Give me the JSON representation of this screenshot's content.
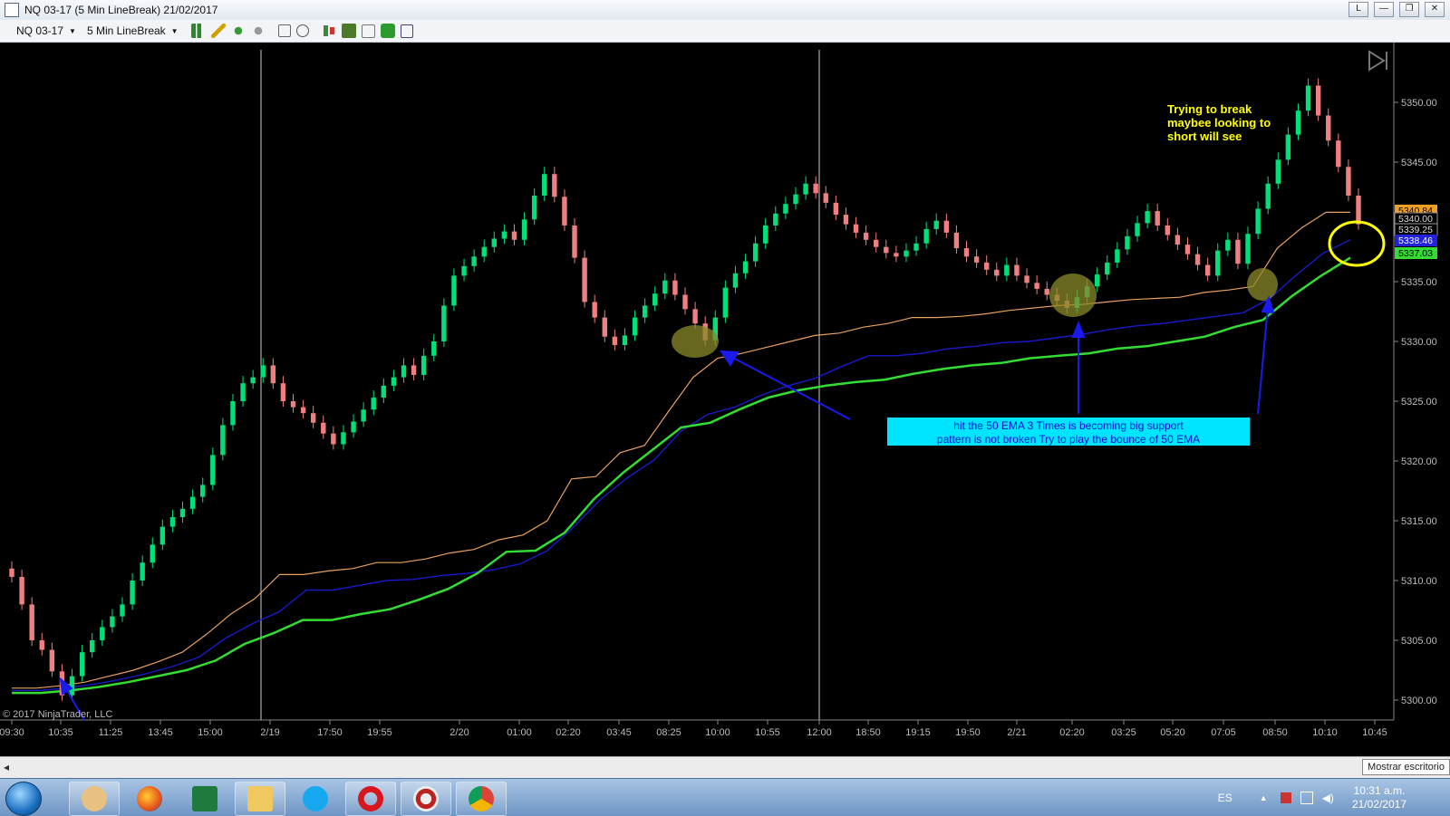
{
  "window": {
    "title": "NQ 03-17 (5 Min LineBreak)  21/02/2017",
    "btn_l": "L",
    "btn_min": "—",
    "btn_max": "❐",
    "btn_close": "✕"
  },
  "toolbar": {
    "instrument": "NQ 03-17",
    "period": "5 Min LineBreak"
  },
  "colors": {
    "up": "#00e07a",
    "down": "#f08080",
    "ema_orange": "#e8a060",
    "ema_blue": "#1a1acc",
    "ema_green": "#33dd33",
    "note_bg": "#00e5ff",
    "note_text": "#1010d0",
    "annotation_yellow": "#ffff00"
  },
  "chart_data": {
    "type": "line",
    "title": "",
    "y_range": [
      5297.5,
      5353.0
    ],
    "y_ticks": [
      "5350.00",
      "5345.00",
      "5340.00",
      "5335.00",
      "5330.00",
      "5325.00",
      "5320.00",
      "5315.00",
      "5310.00",
      "5305.00",
      "5300.00"
    ],
    "x_ticks": [
      "09:30",
      "10:35",
      "11:25",
      "13:45",
      "15:00",
      "2/19",
      "17:50",
      "19:55",
      "2/20",
      "01:00",
      "02:20",
      "03:45",
      "08:25",
      "10:00",
      "10:55",
      "12:00",
      "18:50",
      "19:15",
      "19:50",
      "2/21",
      "02:20",
      "03:25",
      "05:20",
      "07:05",
      "08:50",
      "10:10",
      "10:45"
    ],
    "price_labels": [
      {
        "text": "5340.84",
        "color": "orange",
        "value": 5340.84
      },
      {
        "text": "5340.00",
        "color": "white",
        "value": 5340.0
      },
      {
        "text": "5339.25",
        "color": "white",
        "value": 5339.25
      },
      {
        "text": "5338.46",
        "color": "blue",
        "value": 5338.46
      },
      {
        "text": "5337.03",
        "color": "green",
        "value": 5337.03
      }
    ],
    "bars_close": [
      5310.3,
      5308.0,
      5305.0,
      5304.2,
      5302.4,
      5300.4,
      5302.0,
      5304.0,
      5305.0,
      5306.1,
      5307.0,
      5308.0,
      5310.0,
      5311.5,
      5313.0,
      5314.5,
      5315.3,
      5316.0,
      5317.0,
      5318.0,
      5320.5,
      5323.0,
      5325.0,
      5326.5,
      5327.0,
      5328.0,
      5326.5,
      5325.0,
      5324.5,
      5324.0,
      5323.2,
      5322.3,
      5321.4,
      5322.4,
      5323.3,
      5324.3,
      5325.3,
      5326.3,
      5327.0,
      5328.0,
      5327.2,
      5328.8,
      5330.0,
      5333.0,
      5335.5,
      5336.3,
      5337.1,
      5337.9,
      5338.6,
      5339.2,
      5338.5,
      5340.2,
      5342.2,
      5344.0,
      5342.1,
      5339.7,
      5337.0,
      5333.3,
      5332.0,
      5330.4,
      5329.7,
      5330.5,
      5332.0,
      5333.0,
      5334.0,
      5335.1,
      5333.9,
      5332.7,
      5331.5,
      5330.1,
      5332.0,
      5334.5,
      5335.7,
      5336.7,
      5338.2,
      5339.7,
      5340.7,
      5341.5,
      5342.3,
      5343.2,
      5342.4,
      5341.6,
      5340.6,
      5339.8,
      5339.1,
      5338.5,
      5337.9,
      5337.4,
      5337.1,
      5337.6,
      5338.2,
      5339.4,
      5340.1,
      5339.1,
      5337.8,
      5337.1,
      5336.6,
      5336.0,
      5335.5,
      5336.4,
      5335.5,
      5334.9,
      5334.4,
      5333.9,
      5333.4,
      5332.8,
      5333.7,
      5334.6,
      5335.6,
      5336.6,
      5337.7,
      5338.8,
      5339.9,
      5340.9,
      5339.7,
      5338.9,
      5338.1,
      5337.3,
      5336.4,
      5335.5,
      5337.6,
      5338.5,
      5336.5,
      5339.0,
      5341.1,
      5343.2,
      5345.2,
      5347.3,
      5349.3,
      5351.4,
      5348.9,
      5346.8,
      5344.6,
      5342.2,
      5339.8
    ],
    "ema_orange": [
      5301.0,
      5301.0,
      5301.2,
      5301.5,
      5302.0,
      5302.5,
      5303.2,
      5304.0,
      5305.5,
      5307.2,
      5308.5,
      5310.5,
      5310.5,
      5310.8,
      5311.0,
      5311.5,
      5311.5,
      5311.8,
      5312.3,
      5312.6,
      5313.4,
      5313.8,
      5315.0,
      5318.5,
      5318.7,
      5320.7,
      5321.3,
      5324.2,
      5327.0,
      5328.6,
      5329.0,
      5329.5,
      5330.0,
      5330.5,
      5330.7,
      5331.2,
      5331.5,
      5332.0,
      5332.0,
      5332.1,
      5332.3,
      5332.6,
      5332.8,
      5333.0,
      5333.1,
      5333.3,
      5333.5,
      5333.6,
      5333.7,
      5334.1,
      5334.3,
      5334.6,
      5337.8,
      5339.5,
      5340.8,
      5340.8
    ],
    "ema_blue": [
      5300.8,
      5300.8,
      5301.0,
      5301.3,
      5301.7,
      5302.2,
      5302.8,
      5303.6,
      5305.2,
      5306.4,
      5307.4,
      5309.2,
      5309.2,
      5309.6,
      5310.0,
      5310.1,
      5310.4,
      5310.6,
      5310.9,
      5311.4,
      5312.5,
      5314.5,
      5316.8,
      5318.6,
      5320.1,
      5322.5,
      5323.9,
      5324.5,
      5325.5,
      5326.3,
      5326.9,
      5327.9,
      5328.8,
      5328.8,
      5329.0,
      5329.4,
      5329.6,
      5329.9,
      5330.0,
      5330.3,
      5330.6,
      5331.0,
      5331.3,
      5331.5,
      5331.8,
      5332.1,
      5332.4,
      5333.6,
      5335.6,
      5337.4,
      5338.5
    ],
    "ema_green": [
      5300.6,
      5300.6,
      5300.8,
      5301.1,
      5301.5,
      5302.0,
      5302.5,
      5303.3,
      5304.7,
      5305.6,
      5306.7,
      5306.7,
      5307.2,
      5307.6,
      5308.4,
      5309.3,
      5310.6,
      5312.4,
      5312.5,
      5314.0,
      5316.8,
      5319.0,
      5320.9,
      5322.8,
      5323.2,
      5324.3,
      5325.3,
      5325.9,
      5326.3,
      5326.6,
      5326.8,
      5327.3,
      5327.7,
      5328.0,
      5328.2,
      5328.6,
      5328.8,
      5329.0,
      5329.4,
      5329.6,
      5330.0,
      5330.4,
      5331.2,
      5331.8,
      5333.8,
      5335.5,
      5337.0
    ]
  },
  "annotations": {
    "top_note": [
      "Trying to break",
      "maybee looking to",
      "short will see"
    ],
    "box_note": [
      "hit the 50 EMA 3 Times is becoming big support",
      "pattern is not broken Try to play the bounce of 50 EMA"
    ],
    "copyright": "© 2017 NinjaTrader, LLC"
  },
  "status": {
    "tooltip": "Mostrar escritorio",
    "lang": "ES",
    "time": "10:31 a.m.",
    "date": "21/02/2017"
  },
  "taskbar": {
    "apps": [
      "hand-tool-app",
      "firefox",
      "excel",
      "file-explorer",
      "skype",
      "opera",
      "ninjatrader",
      "chrome"
    ]
  }
}
